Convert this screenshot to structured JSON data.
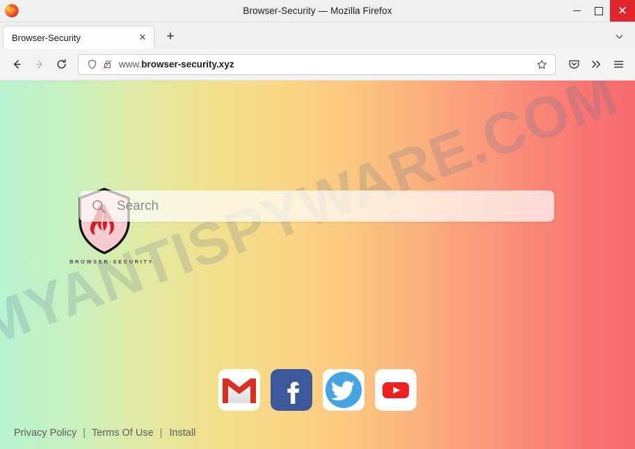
{
  "window": {
    "title": "Browser-Security — Mozilla Firefox",
    "controls": {
      "minimize": "minimize-button",
      "maximize": "maximize-button",
      "close": "✕"
    },
    "close_color": "#e2252a"
  },
  "tabs": {
    "items": [
      {
        "label": "Browser-Security",
        "close": "✕"
      }
    ],
    "new_tab": "+",
    "list_all_tabs": "list-all-tabs"
  },
  "toolbar": {
    "back": "back-button",
    "forward": "forward-button",
    "reload": "reload-button",
    "url_prefix": "www.",
    "url_domain": "browser-security.xyz",
    "url_full": "www.browser-security.xyz",
    "shield_tooltip": "tracking-protection",
    "lock_state": "insecure",
    "bookmark": "bookmark-star",
    "pocket": "save-to-pocket",
    "overflow": "»",
    "menu": "application-menu"
  },
  "page": {
    "watermark": "MYANTISPYWARE.COM",
    "logo": {
      "caption": "BROWSER-SECURITY",
      "shield_outline": "#111111",
      "shield_fill": "#f6c9cd",
      "flame_color": "#d42027"
    },
    "search": {
      "placeholder": "Search",
      "value": "",
      "icon": "magnifier-icon"
    },
    "shortcuts": [
      {
        "name": "Gmail",
        "icon": "gmail-icon",
        "color": "#d93025"
      },
      {
        "name": "Facebook",
        "icon": "facebook-icon",
        "color": "#3b5998"
      },
      {
        "name": "Twitter",
        "icon": "twitter-icon",
        "color": "#55acee"
      },
      {
        "name": "YouTube",
        "icon": "youtube-icon",
        "color": "#ff0000"
      }
    ],
    "footer": {
      "privacy": "Privacy Policy",
      "separator1": "|",
      "terms": "Terms Of Use",
      "separator2": "|",
      "install": "Install"
    },
    "gradient_stops": [
      "#b6f3cf",
      "#f2e08c",
      "#fbc27e",
      "#f66a6e"
    ]
  }
}
